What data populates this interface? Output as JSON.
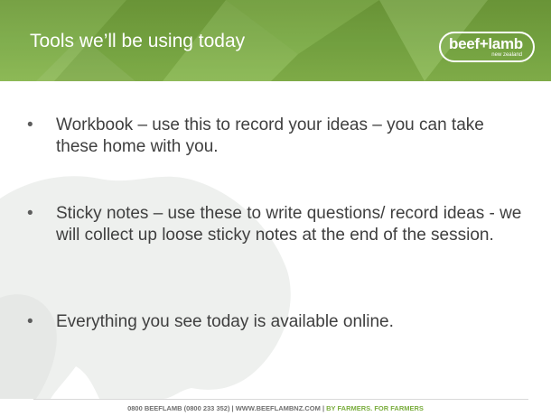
{
  "slide": {
    "title": "Tools we’ll be using today",
    "logo": {
      "main": "beef+lamb",
      "sub": "new zealand"
    },
    "bullets": [
      {
        "marker": "•",
        "text": "Workbook – use this to record your ideas – you can take these home with you."
      },
      {
        "marker": "•",
        "text": "Sticky notes – use these to write questions/ record ideas - we will collect up loose sticky notes at the end of the session."
      },
      {
        "marker": "•",
        "text": "Everything you see today is available online."
      }
    ],
    "footer": {
      "contact": "0800 BEEFLAMB (0800 233 352) | WWW.BEEFLAMBNZ.COM | ",
      "tagline": "BY FARMERS. FOR FARMERS"
    }
  },
  "colors": {
    "header_green": "#7aaa44",
    "accent_green": "#7aad3e",
    "body_text": "#3f3f3f"
  }
}
